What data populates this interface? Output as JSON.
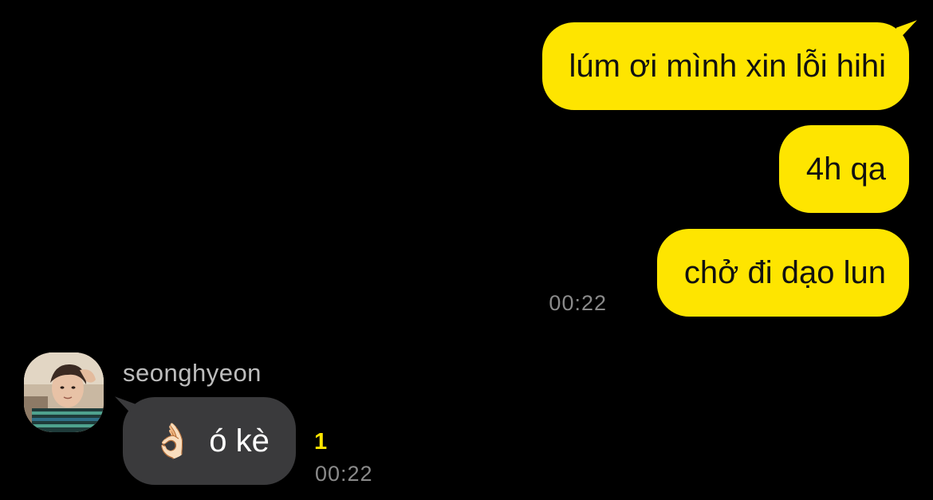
{
  "colors": {
    "background": "#000000",
    "outgoing_bubble": "#FEE500",
    "incoming_bubble": "#3A3A3C",
    "timestamp": "#8A8A8A",
    "unread": "#FEE500"
  },
  "messages_out": [
    {
      "text": "lúm ơi mình xin lỗi hihi"
    },
    {
      "text": "4h qa"
    },
    {
      "text": "chở đi dạo lun"
    }
  ],
  "out_time": "00:22",
  "incoming": {
    "sender": "seonghyeon",
    "avatar_icon": "profile-photo",
    "emoji_icon": "ok-hand-emoji",
    "emoji": "👌🏻",
    "text": "ó kè",
    "unread_count": "1",
    "time": "00:22"
  }
}
